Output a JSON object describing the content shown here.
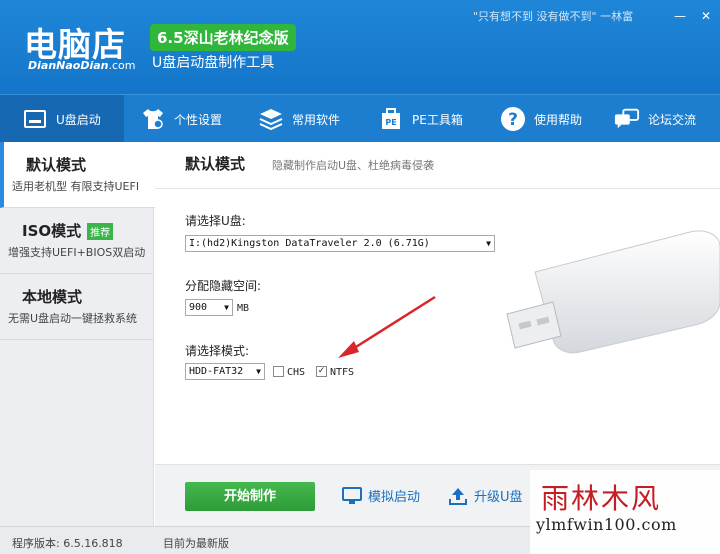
{
  "header": {
    "logo_text": "电脑店",
    "logo_sub_brand": "DianNaoDian",
    "logo_sub_domain": ".com",
    "version_badge": "6.5深山老林纪念版",
    "tagline": "U盘启动盘制作工具",
    "quote": "\"只有想不到 没有做不到\" 一林富",
    "minimize": "—",
    "close": "✕"
  },
  "nav": {
    "items": [
      {
        "label": "U盘启动",
        "icon": "usb-drive-icon"
      },
      {
        "label": "个性设置",
        "icon": "tshirt-icon"
      },
      {
        "label": "常用软件",
        "icon": "layers-icon"
      },
      {
        "label": "PE工具箱",
        "icon": "pe-box-icon"
      },
      {
        "label": "使用帮助",
        "icon": "help-icon"
      },
      {
        "label": "论坛交流",
        "icon": "chat-icon"
      }
    ]
  },
  "sidebar": {
    "items": [
      {
        "title": "默认模式",
        "desc": "适用老机型 有限支持UEFI"
      },
      {
        "title": "ISO模式",
        "badge": "推荐",
        "desc": "增强支持UEFI+BIOS双启动"
      },
      {
        "title": "本地模式",
        "desc": "无需U盘启动一键拯救系统"
      }
    ]
  },
  "content": {
    "title": "默认模式",
    "subtitle": "隐藏制作启动U盘、杜绝病毒侵袭",
    "usb_label": "请选择U盘:",
    "usb_value": "I:(hd2)Kingston DataTraveler 2.0 (6.71G)",
    "space_label": "分配隐藏空间:",
    "space_value": "900",
    "space_unit": "MB",
    "mode_label": "请选择模式:",
    "mode_value": "HDD-FAT32",
    "chs_label": "CHS",
    "chs_checked": false,
    "ntfs_label": "NTFS",
    "ntfs_checked": true,
    "check_mark": "✓",
    "start_button": "开始制作",
    "simulate_button": "模拟启动",
    "upgrade_button": "升级U盘"
  },
  "status": {
    "version": "程序版本: 6.5.16.818",
    "update": "目前为最新版"
  },
  "watermark": {
    "cn": "雨林木风",
    "en": "ylmfwin100.com"
  },
  "colors": {
    "header_blue": "#1f86d8",
    "nav_active": "#1768b3",
    "badge_green": "#2fb63b",
    "start_green": "#3aab43",
    "arrow_red": "#d9262b"
  }
}
